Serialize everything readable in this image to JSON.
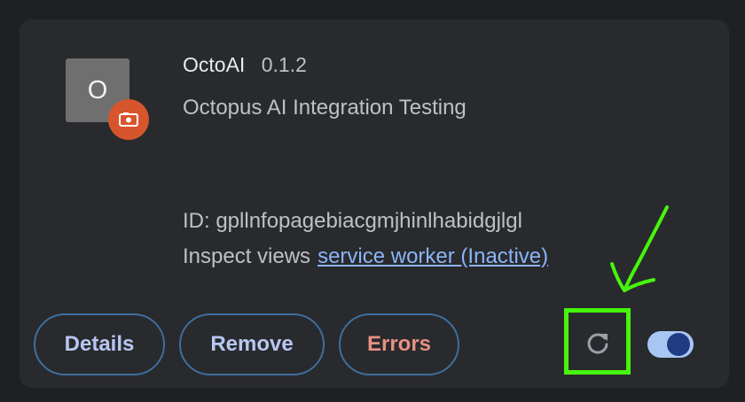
{
  "extension": {
    "icon_letter": "O",
    "name": "OctoAI",
    "version": "0.1.2",
    "description": "Octopus AI Integration Testing",
    "id_text": "ID: gpllnfopagebiacgmjhinlhabidgjlgl",
    "inspect_label": "Inspect views",
    "inspect_link": "service worker (Inactive)"
  },
  "actions": {
    "details_label": "Details",
    "remove_label": "Remove",
    "errors_label": "Errors"
  },
  "toggle": {
    "enabled": true
  },
  "icons": {
    "badge": "camera-badge-icon",
    "reload": "reload-icon"
  },
  "colors": {
    "card_bg": "#292a2d",
    "link": "#8ab4f8",
    "button_text": "#b7c7f2",
    "errors_text": "#e69184",
    "button_border": "#3d6f9f",
    "badge_bg": "#d7552d",
    "annotation_green": "#45f60c"
  }
}
